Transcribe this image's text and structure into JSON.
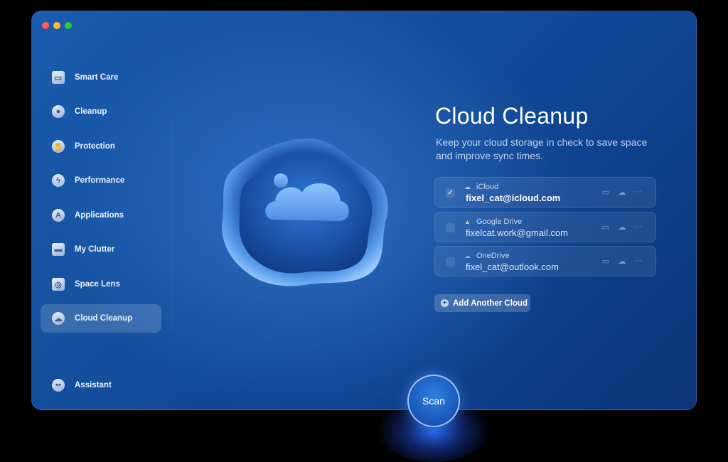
{
  "sidebar": {
    "items": [
      {
        "label": "Smart Care",
        "icon": "monitor-icon",
        "active": false
      },
      {
        "label": "Cleanup",
        "icon": "disk-icon",
        "active": false
      },
      {
        "label": "Protection",
        "icon": "hand-icon",
        "active": false
      },
      {
        "label": "Performance",
        "icon": "lightning-icon",
        "active": false
      },
      {
        "label": "Applications",
        "icon": "app-store-icon",
        "active": false
      },
      {
        "label": "My Clutter",
        "icon": "folder-icon",
        "active": false
      },
      {
        "label": "Space Lens",
        "icon": "lens-icon",
        "active": false
      },
      {
        "label": "Cloud Cleanup",
        "icon": "cloud-icon",
        "active": true
      }
    ],
    "assistant_label": "Assistant"
  },
  "main": {
    "title": "Cloud Cleanup",
    "subtitle": "Keep your cloud storage in check to save space and improve sync times.",
    "accounts": [
      {
        "provider": "iCloud",
        "email": "fixel_cat@icloud.com",
        "checked": true,
        "icon": "icloud-icon"
      },
      {
        "provider": "Google Drive",
        "email": "fixelcat.work@gmail.com",
        "checked": false,
        "icon": "google-drive-icon"
      },
      {
        "provider": "OneDrive",
        "email": "fixel_cat@outlook.com",
        "checked": false,
        "icon": "onedrive-icon"
      }
    ],
    "add_cloud_label": "Add Another Cloud",
    "scan_label": "Scan"
  },
  "colors": {
    "window_bg": "#14509e",
    "accent": "#2f7fe0",
    "close": "#ff5f57",
    "minimize": "#febc2e",
    "zoom": "#28c840"
  }
}
